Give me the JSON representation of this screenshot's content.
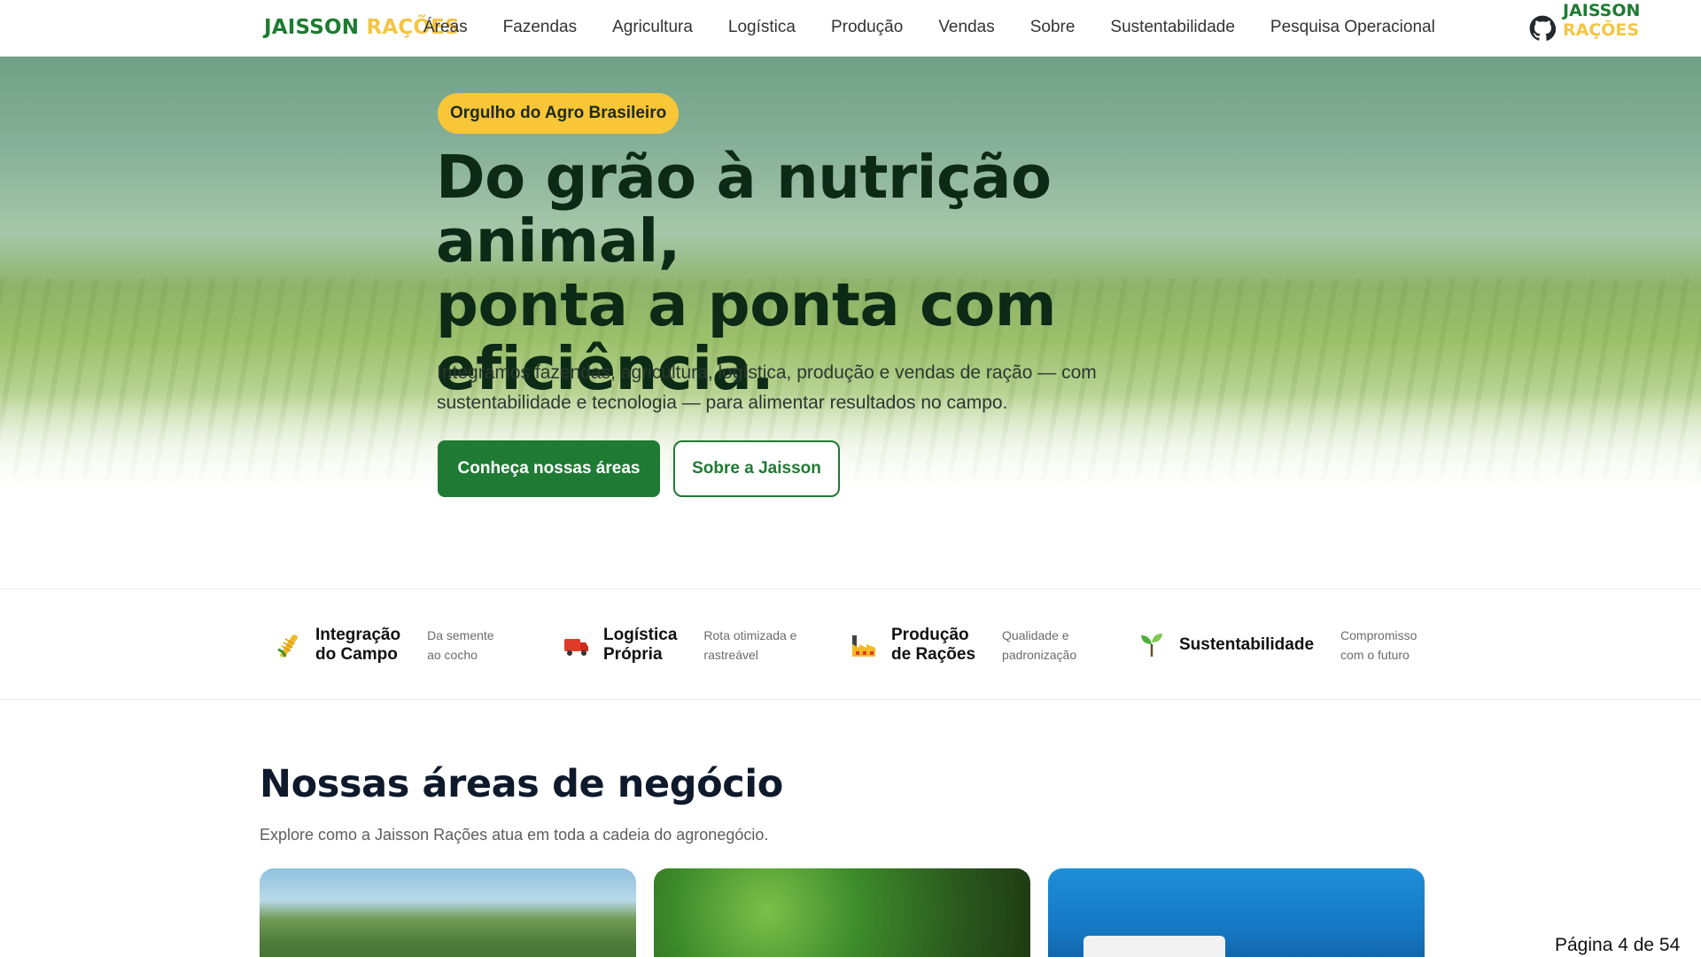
{
  "nav": {
    "brand_part1": "JAISSON",
    "brand_part2": "RAÇÕES",
    "links": [
      "Áreas",
      "Fazendas",
      "Agricultura",
      "Logística",
      "Produção",
      "Vendas",
      "Sobre",
      "Sustentabilidade",
      "Pesquisa Operacional"
    ],
    "github_icon": "github-icon"
  },
  "corner_brand": {
    "part1": "JAISSON",
    "part2": "RAÇÕES"
  },
  "hero": {
    "badge": "Orgulho do Agro Brasileiro",
    "headline_line1": "Do grão à nutrição animal,",
    "headline_line2": "ponta a ponta com",
    "headline_line3": "eficiência.",
    "subtitle_line1": "Integramos fazendas, agricultura, logística, produção e vendas de ração — com",
    "subtitle_line2": "sustentabilidade e tecnologia — para alimentar resultados no campo.",
    "primary_button": "Conheça nossas áreas",
    "secondary_button": "Sobre a Jaisson"
  },
  "features": [
    {
      "icon": "corn-icon",
      "title_line1": "Integração",
      "title_line2": "do Campo",
      "desc_line1": "Da semente",
      "desc_line2": "ao cocho"
    },
    {
      "icon": "truck-icon",
      "title_line1": "Logística",
      "title_line2": "Própria",
      "desc_line1": "Rota otimizada e",
      "desc_line2": "rastreável"
    },
    {
      "icon": "factory-icon",
      "title_line1": "Produção",
      "title_line2": "de Rações",
      "desc_line1": "Qualidade e",
      "desc_line2": "padronização"
    },
    {
      "icon": "seedling-icon",
      "title_line1": "Sustentabilidade",
      "title_line2": "",
      "desc_line1": "Compromisso",
      "desc_line2": "com o futuro"
    }
  ],
  "section": {
    "title": "Nossas áreas de negócio",
    "subtitle": "Explore como a Jaisson Rações atua em toda a cadeia do agronegócio."
  },
  "page_indicator": "Página 4 de 54",
  "colors": {
    "brand_green": "#1f7a34",
    "brand_yellow": "#f8c637",
    "headline": "#0c2a15"
  }
}
